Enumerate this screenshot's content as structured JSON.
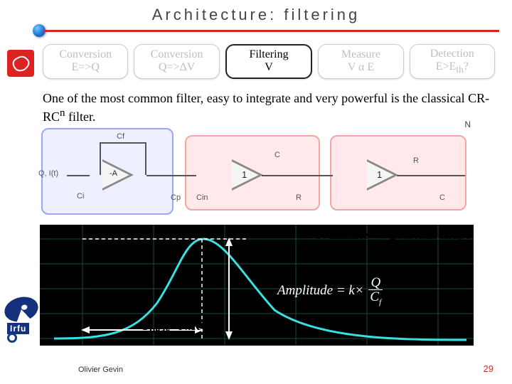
{
  "title": "Architecture: filtering",
  "pipeline": [
    {
      "line1": "Conversion",
      "line2": "E=>Q",
      "active": false
    },
    {
      "line1": "Conversion",
      "line2": "Q=>ΔV",
      "active": false
    },
    {
      "line1": "Filtering",
      "line2": "V",
      "active": true
    },
    {
      "line1": "Measure",
      "line2": "V α E",
      "active": false
    },
    {
      "line1": "Detection",
      "line2_html": "E>E<sub>th</sub>?",
      "active": false
    }
  ],
  "body": {
    "text_html": "One of the most common filter, easy to integrate and very powerful is the classical CR-RC<sup>n</sup> filter."
  },
  "circuit": {
    "input_label": "Q, I(t)",
    "caps": {
      "ci": "Ci",
      "cp": "Cp",
      "cin": "Cin",
      "cf": "Cf",
      "c1": "C",
      "r1": "R",
      "c2": "C",
      "r2": "R"
    },
    "amp_labels": {
      "preamp": "-A",
      "unity1": "1",
      "unity2": "1"
    },
    "n_label": "N"
  },
  "waveform": {
    "right_annot": "N infinite => gaussian shape",
    "formula_lhs": "Amplitude = k×",
    "formula_num": "Q",
    "formula_den": "C",
    "formula_den_sub": "f",
    "tpeak_html": "T<sub>peak</sub>=N.RC"
  },
  "logos": {
    "irfu": "Irfu"
  },
  "footer": {
    "author": "Olivier Gevin",
    "page": "29"
  }
}
